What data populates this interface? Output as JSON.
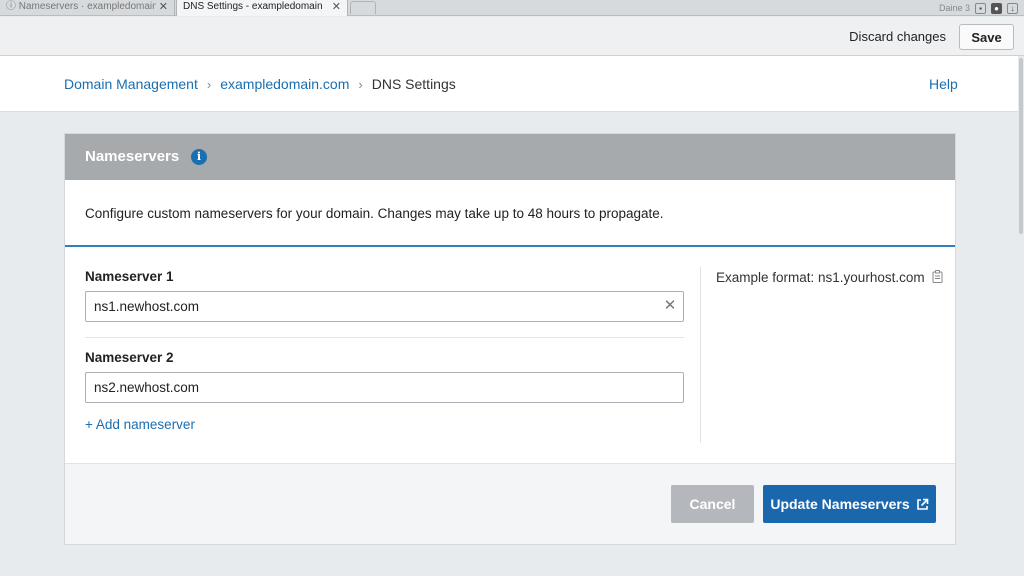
{
  "browser": {
    "tabs": [
      {
        "title": "ⓘ Nameservers · exampledomain · se",
        "active": false
      },
      {
        "title": "DNS Settings - exampledomain",
        "active": true
      }
    ],
    "tab_close": "✕",
    "toolbar_text": "Daine 3"
  },
  "actionbar": {
    "discard_label": "Discard changes",
    "save_label": "Save"
  },
  "breadcrumb": {
    "items": [
      "Domain Management",
      "exampledomain.com"
    ],
    "separator": "›",
    "current": "DNS Settings"
  },
  "help_label": "Help",
  "card": {
    "title": "Nameservers",
    "info_glyph": "i",
    "description": "Configure custom nameservers for your domain. Changes may take up to 48 hours to propagate.",
    "fields": [
      {
        "label": "Nameserver 1",
        "value": "ns1.newhost.com"
      },
      {
        "label": "Nameserver 2",
        "value": "ns2.newhost.com"
      }
    ],
    "clear_glyph": "✕",
    "add_label": "+ Add nameserver",
    "hint": "Example format: ns1.yourhost.com",
    "cancel_label": "Cancel",
    "update_label": "Update Nameservers"
  },
  "colors": {
    "accent": "#1a6fb0",
    "primary_button": "#1b67ad",
    "header_gray": "#a7aaad",
    "disabled_button": "#b4b8bc"
  },
  "icons": {
    "info": "info-icon",
    "clear": "close-icon",
    "copy": "clipboard-icon",
    "external": "external-link-icon"
  }
}
